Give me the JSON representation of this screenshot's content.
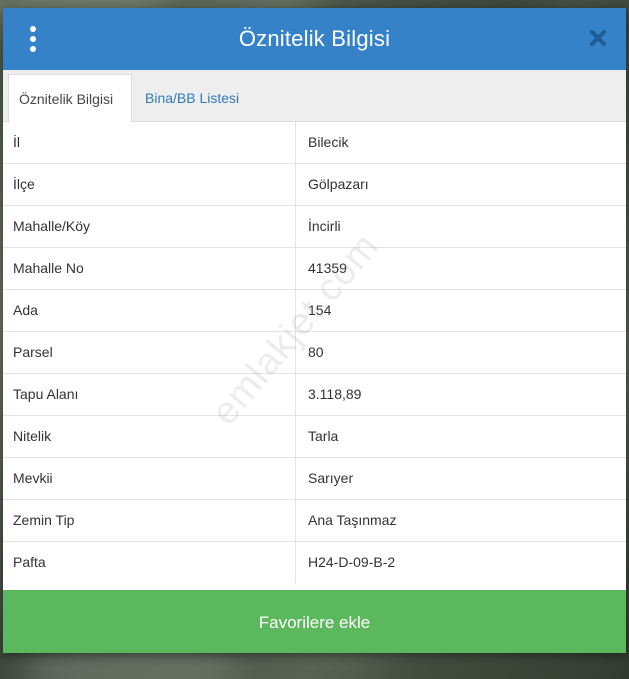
{
  "header": {
    "title": "Öznitelik Bilgisi",
    "menu_icon": "vertical-dots-icon",
    "close_icon": "close-icon",
    "background": "#3582c8"
  },
  "tabs": [
    {
      "label": "Öznitelik Bilgisi",
      "active": true
    },
    {
      "label": "Bina/BB Listesi",
      "active": false
    }
  ],
  "attributes": [
    {
      "label": "İl",
      "value": "Bilecik"
    },
    {
      "label": "İlçe",
      "value": "Gölpazarı"
    },
    {
      "label": "Mahalle/Köy",
      "value": "İncirli"
    },
    {
      "label": "Mahalle No",
      "value": "41359"
    },
    {
      "label": "Ada",
      "value": "154"
    },
    {
      "label": "Parsel",
      "value": "80"
    },
    {
      "label": "Tapu Alanı",
      "value": "3.118,89"
    },
    {
      "label": "Nitelik",
      "value": "Tarla"
    },
    {
      "label": "Mevkii",
      "value": "Sarıyer"
    },
    {
      "label": "Zemin Tip",
      "value": "Ana Taşınmaz"
    },
    {
      "label": "Pafta",
      "value": "H24-D-09-B-2"
    }
  ],
  "favorite_button": {
    "label": "Favorilere ekle",
    "color": "#5cb85c"
  },
  "watermark": "emlakjet.com"
}
